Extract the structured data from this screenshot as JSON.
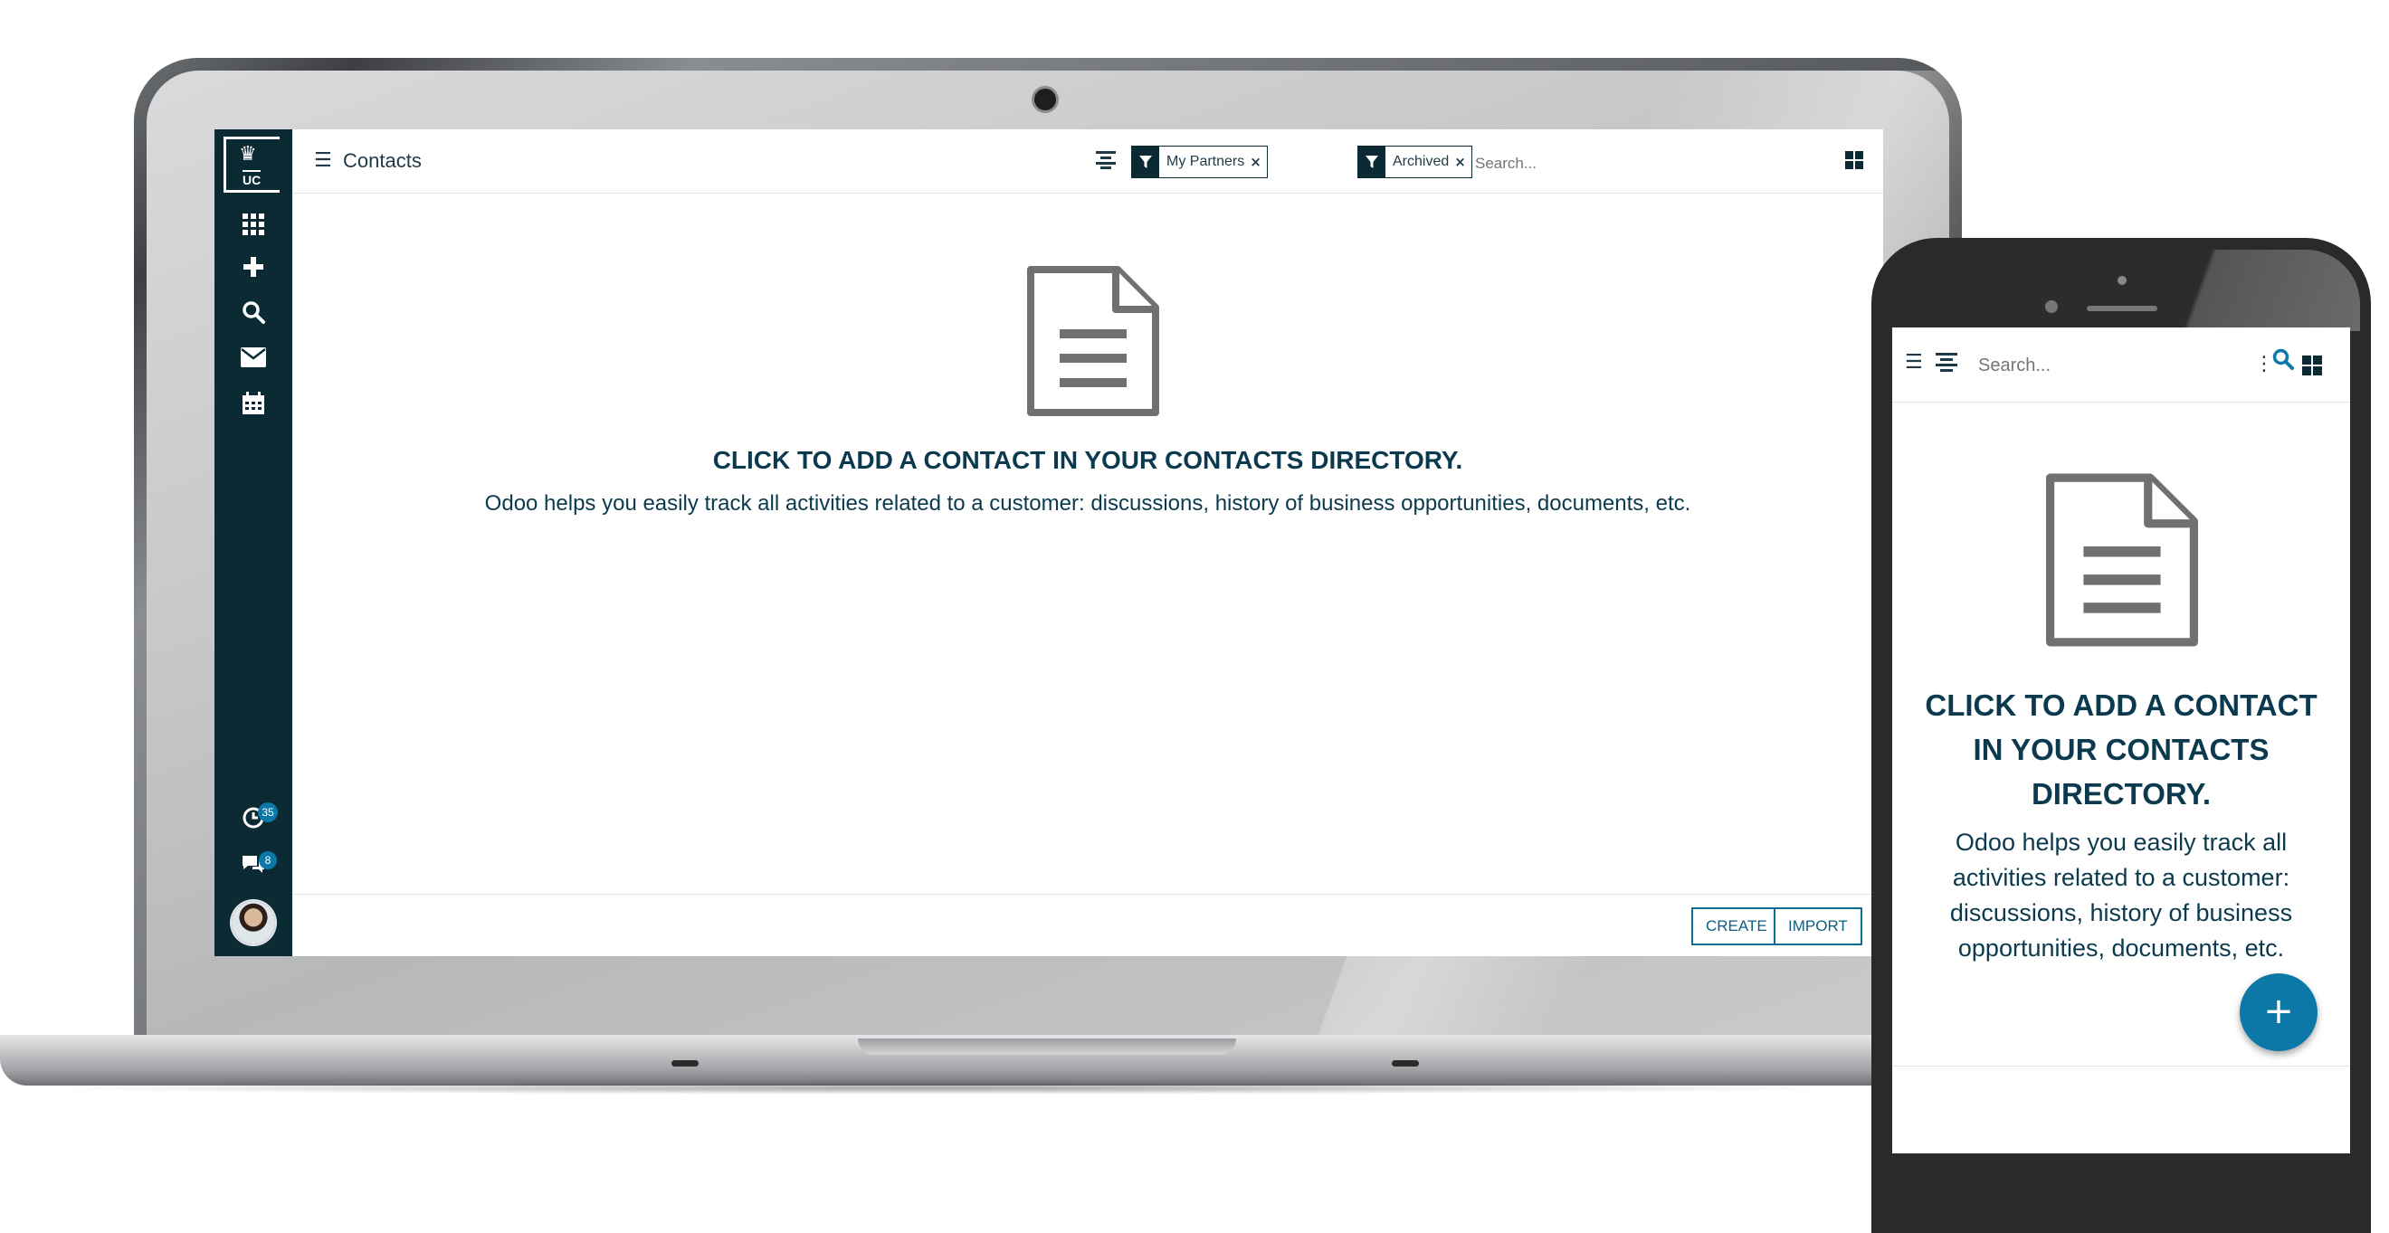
{
  "app": {
    "breadcrumb": "Contacts",
    "logo_text": "UC"
  },
  "sidebar": {
    "items": [
      {
        "icon": "apps-grid-icon"
      },
      {
        "icon": "plus-icon"
      },
      {
        "icon": "search-icon"
      },
      {
        "icon": "envelope-icon"
      },
      {
        "icon": "calendar-icon"
      }
    ],
    "activity_count": "35",
    "messages_count": "8"
  },
  "search": {
    "facets": [
      {
        "icon": "filter-icon",
        "label": "My Partners"
      },
      {
        "icon": "filter-icon",
        "label": "Archived"
      }
    ],
    "placeholder": "Search..."
  },
  "help": {
    "title": "CLICK TO ADD A CONTACT IN YOUR CONTACTS DIRECTORY.",
    "text": "Odoo helps you easily track all activities related to a customer: discussions, history of business opportunities, documents, etc."
  },
  "buttons": {
    "create": "CREATE",
    "import": "IMPORT"
  },
  "mobile": {
    "search_placeholder": "Search...",
    "title": "CLICK TO ADD A CONTACT IN YOUR CONTACTS DIRECTORY.",
    "text": "Odoo helps you easily track all activities related to a customer: discussions, history of business opportunities, documents, etc.",
    "fab": "+"
  },
  "colors": {
    "sidebar": "#0b2a33",
    "accent": "#0b78a8",
    "heading": "#0b3a4f"
  }
}
